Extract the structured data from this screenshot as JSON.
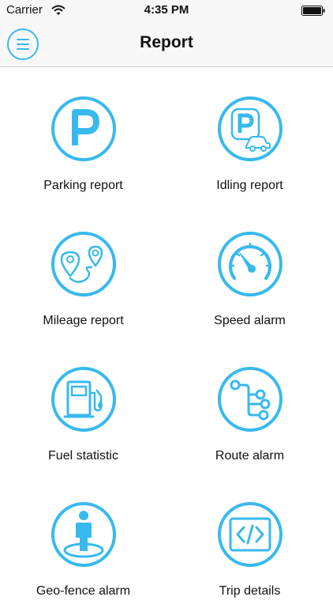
{
  "status_bar": {
    "carrier": "Carrier",
    "time": "4:35 PM"
  },
  "header": {
    "title": "Report",
    "menu_icon": "hamburger-menu-icon"
  },
  "accent_color": "#37b9ee",
  "reports": [
    {
      "label": "Parking report",
      "icon": "parking-icon"
    },
    {
      "label": "Idling report",
      "icon": "idling-car-icon"
    },
    {
      "label": "Mileage report",
      "icon": "route-pins-icon"
    },
    {
      "label": "Speed alarm",
      "icon": "speedometer-icon"
    },
    {
      "label": "Fuel statistic",
      "icon": "fuel-pump-icon"
    },
    {
      "label": "Route alarm",
      "icon": "route-nodes-icon"
    },
    {
      "label": "Geo-fence alarm",
      "icon": "person-geofence-icon"
    },
    {
      "label": "Trip details",
      "icon": "code-brackets-icon"
    }
  ]
}
